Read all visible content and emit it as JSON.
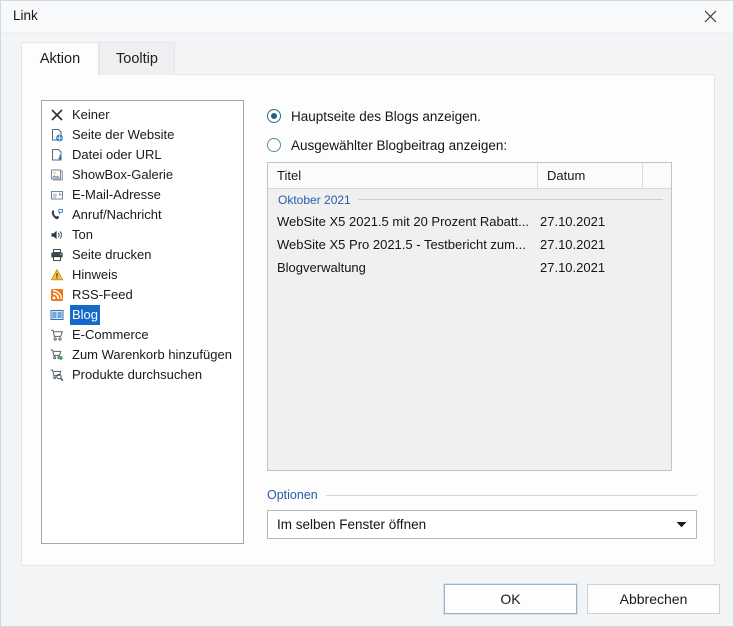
{
  "window": {
    "title": "Link",
    "close_icon": "close-icon"
  },
  "tabs": [
    {
      "label": "Aktion",
      "active": true
    },
    {
      "label": "Tooltip",
      "active": false
    }
  ],
  "action_list": {
    "items": [
      {
        "label": "Keiner",
        "icon": "cross-icon",
        "selected": false
      },
      {
        "label": "Seite der Website",
        "icon": "page-globe-icon",
        "selected": false
      },
      {
        "label": "Datei oder URL",
        "icon": "file-download-icon",
        "selected": false
      },
      {
        "label": "ShowBox-Galerie",
        "icon": "gallery-icon",
        "selected": false
      },
      {
        "label": "E-Mail-Adresse",
        "icon": "envelope-icon",
        "selected": false
      },
      {
        "label": "Anruf/Nachricht",
        "icon": "phone-message-icon",
        "selected": false
      },
      {
        "label": "Ton",
        "icon": "speaker-icon",
        "selected": false
      },
      {
        "label": "Seite drucken",
        "icon": "printer-icon",
        "selected": false
      },
      {
        "label": "Hinweis",
        "icon": "warning-icon",
        "selected": false
      },
      {
        "label": "RSS-Feed",
        "icon": "rss-icon",
        "selected": false
      },
      {
        "label": "Blog",
        "icon": "blog-icon",
        "selected": true
      },
      {
        "label": "E-Commerce",
        "icon": "cart-icon",
        "selected": false
      },
      {
        "label": "Zum Warenkorb hinzufügen",
        "icon": "cart-add-icon",
        "selected": false
      },
      {
        "label": "Produkte durchsuchen",
        "icon": "cart-search-icon",
        "selected": false
      }
    ]
  },
  "blog_options": {
    "radios": [
      {
        "label": "Hauptseite des Blogs anzeigen.",
        "checked": true
      },
      {
        "label": "Ausgewählter Blogbeitrag anzeigen:",
        "checked": false
      }
    ],
    "table": {
      "columns": [
        "Titel",
        "Datum",
        ""
      ],
      "groups": [
        {
          "label": "Oktober 2021",
          "rows": [
            {
              "title": "WebSite X5 2021.5 mit 20 Prozent Rabatt...",
              "date": "27.10.2021"
            },
            {
              "title": "WebSite X5 Pro 2021.5 - Testbericht zum...",
              "date": "27.10.2021"
            },
            {
              "title": "Blogverwaltung",
              "date": "27.10.2021"
            }
          ]
        }
      ]
    }
  },
  "options": {
    "title": "Optionen",
    "target_value": "Im selben Fenster öffnen",
    "dropdown_icon": "chevron-down-icon"
  },
  "footer": {
    "ok_label": "OK",
    "cancel_label": "Abbrechen"
  },
  "colors": {
    "selection_blue": "#1669c8",
    "accent_blue": "#2a5ca8",
    "radio_teal": "#1f5f7d"
  }
}
